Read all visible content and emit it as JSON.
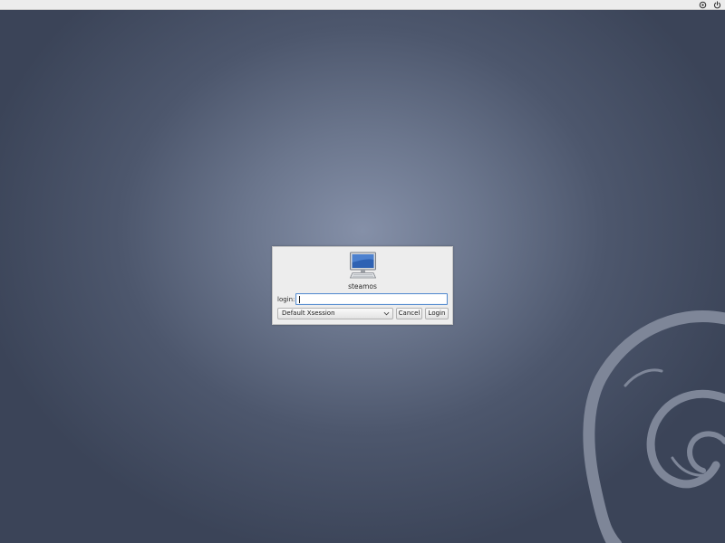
{
  "top_panel": {
    "icons": [
      "session-icon",
      "power-icon"
    ]
  },
  "dialog": {
    "icon": "computer-icon",
    "hostname": "steamos",
    "login_label": "login:",
    "login_value": "",
    "session": {
      "selected": "Default Xsession",
      "icon": "chevron-down-icon"
    },
    "cancel_label": "Cancel",
    "login_button_label": "Login"
  },
  "background": {
    "logo": "debian-swirl",
    "colors": {
      "center": "#8590a8",
      "edge": "#3b4458",
      "swirl": "#7e8698"
    }
  }
}
